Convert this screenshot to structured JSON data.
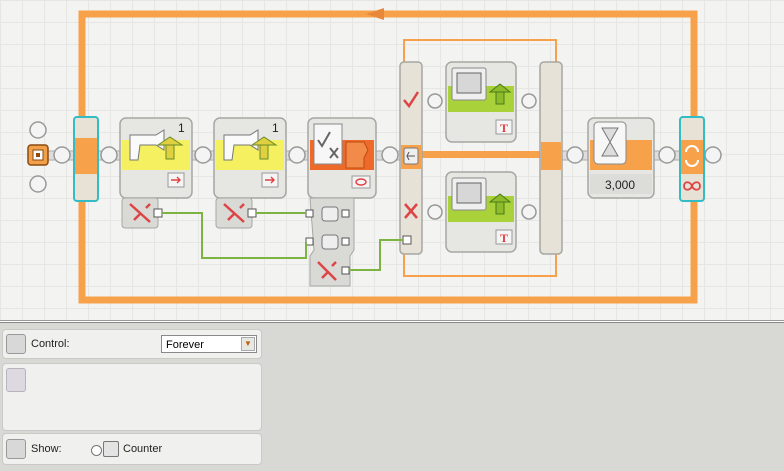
{
  "program": {
    "sensor_1_port": "1",
    "sensor_2_port": "1",
    "wait_time": "3,000"
  },
  "config_panel": {
    "control_label": "Control:",
    "control_value": "Forever",
    "show_label": "Show:",
    "counter_label": "Counter"
  },
  "colors": {
    "loop_orange": "#f7a24a",
    "sensor_yellow": "#f5f060",
    "compare_orange": "#ee6a2a",
    "display_green": "#a9d23a",
    "data_wire_green": "#7cb342",
    "selection_cyan": "#33bcc4"
  },
  "icons": {
    "start": "start-point-icon",
    "touch_sensor": "touch-sensor-icon",
    "compare": "compare-icon",
    "switch_true": "check-mark-icon",
    "switch_false": "x-mark-icon",
    "display": "display-screen-icon",
    "wait": "hourglass-icon",
    "loop": "loop-arrows-icon",
    "infinite": "infinity-icon"
  }
}
